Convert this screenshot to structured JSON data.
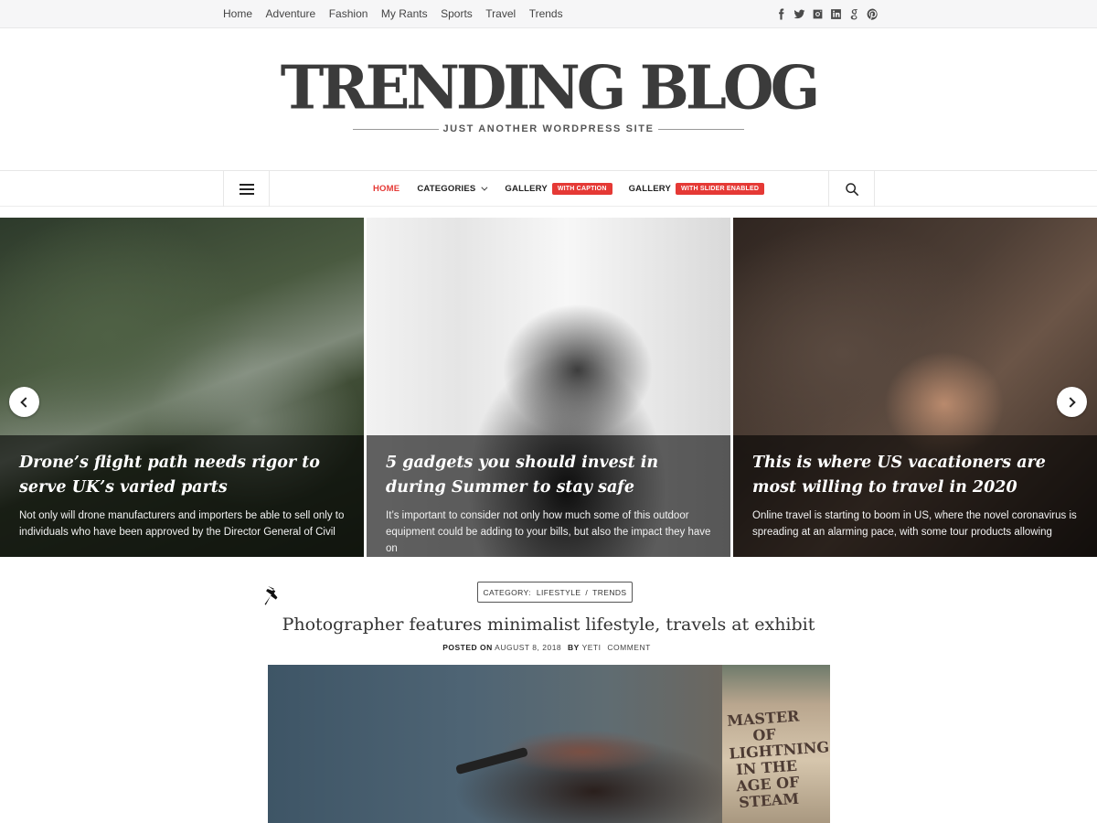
{
  "topbar": {
    "menu": [
      "Home",
      "Adventure",
      "Fashion",
      "My Rants",
      "Sports",
      "Travel",
      "Trends"
    ],
    "social_icons": [
      "facebook-icon",
      "twitter-icon",
      "instagram-icon",
      "linkedin-icon",
      "google-plus-icon",
      "pinterest-icon"
    ]
  },
  "header": {
    "title": "TRENDING BLOG",
    "tagline": "JUST ANOTHER WORDPRESS SITE"
  },
  "nav": {
    "items": [
      {
        "label": "HOME"
      },
      {
        "label": "CATEGORIES"
      },
      {
        "label": "GALLERY",
        "badge": "WITH CAPTION"
      },
      {
        "label": "GALLERY",
        "badge": "WITH SLIDER ENABLED"
      }
    ],
    "accent_color": "#e53935"
  },
  "slider": {
    "slides": [
      {
        "title": "Drone’s flight path needs rigor to serve UK’s varied parts",
        "excerpt": "Not only will drone manufacturers and importers be able to sell only to individuals who have been approved by the Director General of Civil"
      },
      {
        "title": "5 gadgets you should invest in during Summer to stay safe",
        "excerpt": "It’s important to consider not only how much some of this outdoor equipment could be adding to your bills, but also the impact they have on"
      },
      {
        "title": "This is where US vacationers are most willing to travel in 2020",
        "excerpt": "Online travel is starting to boom in US, where the novel coronavirus is spreading at an alarming pace, with some tour products allowing"
      }
    ]
  },
  "post": {
    "category_label": "CATEGORY:",
    "categories": [
      "LIFESTYLE",
      "TRENDS"
    ],
    "category_sep": "/",
    "title": "Photographer features minimalist lifestyle, travels at exhibit",
    "posted_on_label": "POSTED ON",
    "date": "AUGUST 8, 2018",
    "by_label": "BY",
    "author": "YETI",
    "comment_label": "COMMENT",
    "image_text": "MASTER OF LIGHTNING IN THE AGE OF STEAM"
  }
}
